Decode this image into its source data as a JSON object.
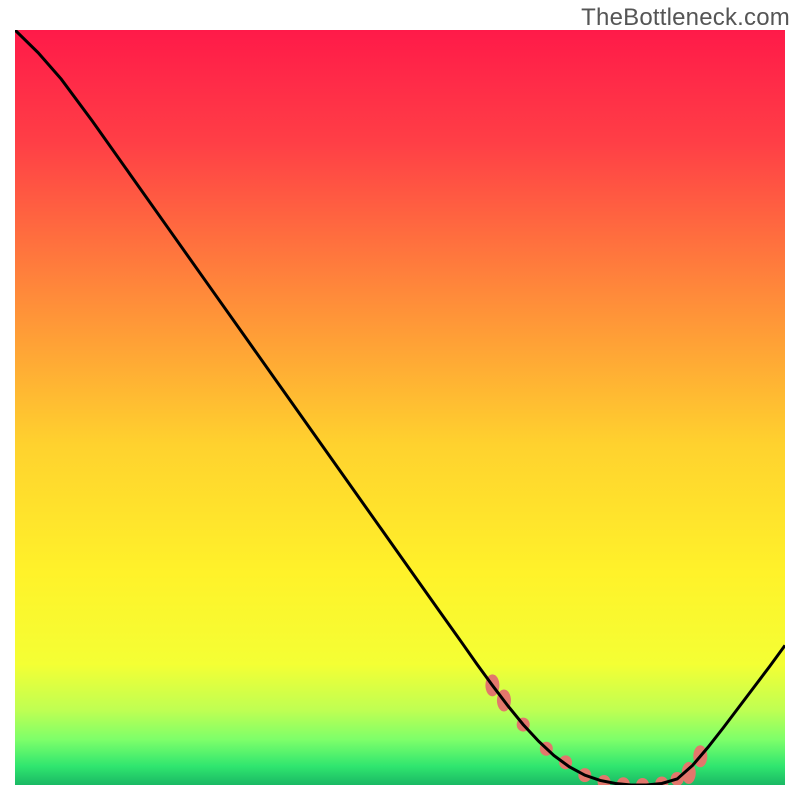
{
  "watermark": "TheBottleneck.com",
  "chart_data": {
    "type": "line",
    "title": "",
    "xlabel": "",
    "ylabel": "",
    "xlim": [
      0,
      100
    ],
    "ylim": [
      0,
      100
    ],
    "x": [
      0,
      3,
      6,
      10,
      15,
      20,
      25,
      30,
      35,
      40,
      45,
      50,
      55,
      58,
      60,
      62,
      64,
      66,
      68,
      70,
      72,
      74,
      76,
      78,
      80,
      82,
      84,
      86,
      88,
      90,
      92,
      94,
      96,
      98,
      100
    ],
    "y": [
      100,
      97,
      93.5,
      88,
      80.8,
      73.6,
      66.4,
      59.2,
      52,
      44.8,
      37.6,
      30.4,
      23.2,
      18.9,
      16.0,
      13.2,
      10.5,
      8.0,
      5.8,
      3.9,
      2.4,
      1.3,
      0.6,
      0.2,
      0.0,
      0.0,
      0.2,
      0.8,
      2.6,
      5.0,
      7.6,
      10.3,
      13.0,
      15.7,
      18.5
    ],
    "markers_x": [
      62,
      63.5,
      66,
      69,
      71.5,
      74,
      76.5,
      79,
      81.5,
      84,
      86,
      87.5,
      89
    ],
    "markers_y": [
      13.2,
      11.2,
      8.0,
      4.8,
      3.0,
      1.3,
      0.4,
      0.1,
      0.0,
      0.2,
      0.8,
      1.6,
      3.8
    ],
    "gradient_stops": [
      {
        "offset": 0.0,
        "color": "#ff1a49"
      },
      {
        "offset": 0.15,
        "color": "#ff3f46"
      },
      {
        "offset": 0.35,
        "color": "#ff8a3a"
      },
      {
        "offset": 0.55,
        "color": "#ffd22e"
      },
      {
        "offset": 0.72,
        "color": "#fff22a"
      },
      {
        "offset": 0.84,
        "color": "#f4ff34"
      },
      {
        "offset": 0.9,
        "color": "#c0ff52"
      },
      {
        "offset": 0.94,
        "color": "#7dff6a"
      },
      {
        "offset": 0.975,
        "color": "#30e66f"
      },
      {
        "offset": 1.0,
        "color": "#1ab864"
      }
    ],
    "grid": false,
    "legend": null,
    "marker_color": "#e2776c",
    "line_color": "#000000"
  }
}
